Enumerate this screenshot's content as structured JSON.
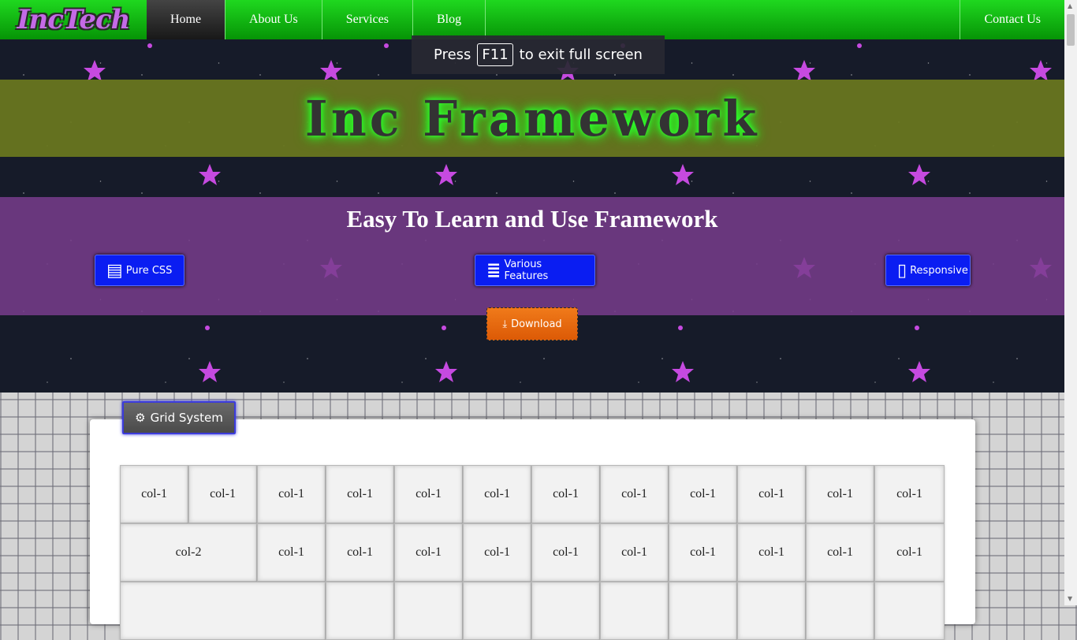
{
  "navbar": {
    "logo": "IncTech",
    "items": [
      {
        "label": "Home",
        "active": true
      },
      {
        "label": "About Us"
      },
      {
        "label": "Services"
      },
      {
        "label": "Blog"
      }
    ],
    "contact": "Contact Us"
  },
  "toast": {
    "prefix": "Press",
    "key": "F11",
    "suffix": "to exit full screen"
  },
  "hero": {
    "title": "Inc Framework",
    "subtitle": "Easy To Learn and Use Framework",
    "features": [
      {
        "label": "Pure CSS",
        "icon": "css3-icon"
      },
      {
        "label": "Various Features",
        "icon": "database-icon"
      },
      {
        "label": "Responsive",
        "icon": "mobile-icon"
      }
    ],
    "download": "Download"
  },
  "grid_section": {
    "button": "Grid System",
    "rows": [
      [
        "col-1",
        "col-1",
        "col-1",
        "col-1",
        "col-1",
        "col-1",
        "col-1",
        "col-1",
        "col-1",
        "col-1",
        "col-1",
        "col-1"
      ],
      [
        "col-2",
        "col-1",
        "col-1",
        "col-1",
        "col-1",
        "col-1",
        "col-1",
        "col-1",
        "col-1",
        "col-1",
        "col-1"
      ],
      [
        "",
        "",
        "",
        "",
        "",
        "",
        "",
        "",
        "",
        "",
        ""
      ]
    ]
  },
  "colors": {
    "nav": "#1fd81f",
    "feature_button": "#0a1df2",
    "download": "#f07a1a",
    "title_glow": "#2cff2c"
  }
}
